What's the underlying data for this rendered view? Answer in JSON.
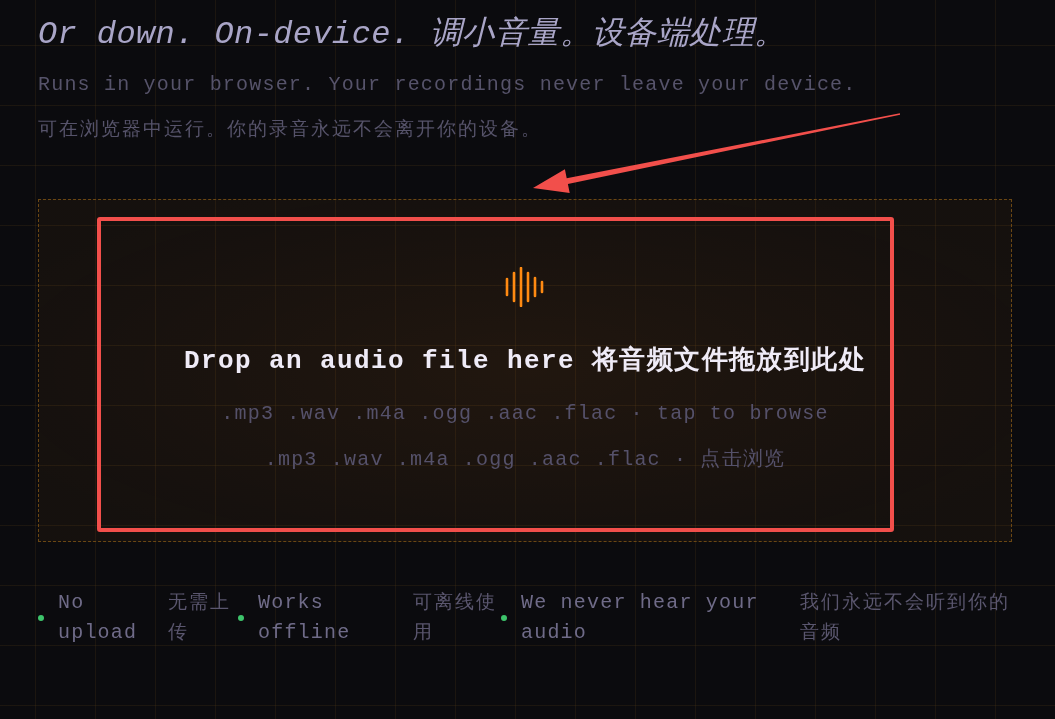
{
  "header": {
    "title": "Or down. On-device. 调小音量。设备端处理。",
    "subtitle": "Runs in your browser. Your recordings never leave your device.",
    "subtitle_zh": "可在浏览器中运行。你的录音永远不会离开你的设备。"
  },
  "dropzone": {
    "heading": "Drop an audio file here 将音频文件拖放到此处",
    "formats": ".mp3 .wav .m4a .ogg .aac .flac · tap to browse",
    "formats_zh": ".mp3 .wav .m4a .ogg .aac .flac · 点击浏览"
  },
  "features": [
    {
      "label": "No upload",
      "label_zh": "无需上传"
    },
    {
      "label": "Works offline",
      "label_zh": "可离线使用"
    },
    {
      "label": "We never hear your audio",
      "label_zh": "我们永远不会听到你的音频"
    }
  ],
  "annotations": {
    "arrow": true,
    "highlight": true
  }
}
